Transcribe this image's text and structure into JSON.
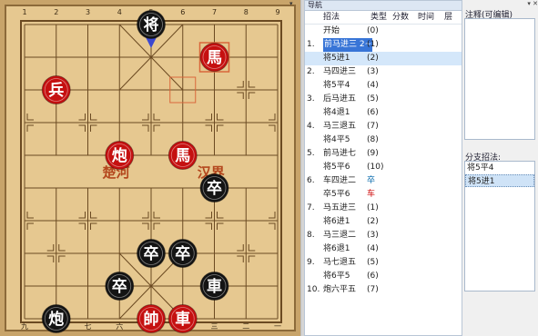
{
  "board": {
    "top_file_labels": [
      "1",
      "2",
      "3",
      "4",
      "5",
      "6",
      "7",
      "8",
      "9"
    ],
    "bottom_file_labels": [
      "九",
      "八",
      "七",
      "六",
      "五",
      "四",
      "三",
      "二",
      "一"
    ],
    "river_left": "楚河",
    "river_right": "汉界",
    "pieces": [
      {
        "char": "将",
        "side": "black",
        "col": 4,
        "row": 0
      },
      {
        "char": "馬",
        "side": "red",
        "col": 6,
        "row": 1
      },
      {
        "char": "兵",
        "side": "red",
        "col": 1,
        "row": 2
      },
      {
        "char": "炮",
        "side": "red",
        "col": 3,
        "row": 4
      },
      {
        "char": "馬",
        "side": "red",
        "col": 5,
        "row": 4
      },
      {
        "char": "卒",
        "side": "black",
        "col": 6,
        "row": 5
      },
      {
        "char": "卒",
        "side": "black",
        "col": 4,
        "row": 7
      },
      {
        "char": "卒",
        "side": "black",
        "col": 5,
        "row": 7
      },
      {
        "char": "卒",
        "side": "black",
        "col": 3,
        "row": 8
      },
      {
        "char": "車",
        "side": "black",
        "col": 6,
        "row": 8
      },
      {
        "char": "炮",
        "side": "black",
        "col": 1,
        "row": 9
      },
      {
        "char": "帥",
        "side": "red",
        "col": 4,
        "row": 9
      },
      {
        "char": "車",
        "side": "red",
        "col": 5,
        "row": 9
      }
    ],
    "colors": {
      "wood": "#e6c890",
      "line": "#6b4a22",
      "red": "#c51010",
      "black": "#141414",
      "river_text": "#b4481e",
      "highlight": "#d9673b",
      "arrow": "#3c48d0"
    }
  },
  "nav": {
    "title": "导航",
    "columns": {
      "move": "招法",
      "type": "类型",
      "score": "分数",
      "time": "时间",
      "depth": "层"
    },
    "rows": [
      {
        "num": "",
        "move": "开始",
        "idx": "(0)",
        "type": "",
        "type_color": "",
        "selected": false
      },
      {
        "num": "1.",
        "move": "前马进三 2~",
        "idx": "(1)",
        "type": "",
        "type_color": "",
        "selected": false,
        "hl": true
      },
      {
        "num": "",
        "move": "将5进1",
        "idx": "(2)",
        "type": "",
        "type_color": "",
        "selected": true
      },
      {
        "num": "2.",
        "move": "马四进三",
        "idx": "(3)",
        "type": "",
        "type_color": "",
        "selected": false
      },
      {
        "num": "",
        "move": "将5平4",
        "idx": "(4)",
        "type": "",
        "type_color": "",
        "selected": false
      },
      {
        "num": "3.",
        "move": "后马进五",
        "idx": "(5)",
        "type": "",
        "type_color": "",
        "selected": false
      },
      {
        "num": "",
        "move": "将4退1",
        "idx": "(6)",
        "type": "",
        "type_color": "",
        "selected": false
      },
      {
        "num": "4.",
        "move": "马三退五",
        "idx": "(7)",
        "type": "",
        "type_color": "",
        "selected": false
      },
      {
        "num": "",
        "move": "将4平5",
        "idx": "(8)",
        "type": "",
        "type_color": "",
        "selected": false
      },
      {
        "num": "5.",
        "move": "前马进七",
        "idx": "(9)",
        "type": "",
        "type_color": "",
        "selected": false
      },
      {
        "num": "",
        "move": "将5平6",
        "idx": "(10)",
        "type": "",
        "type_color": "",
        "selected": false
      },
      {
        "num": "6.",
        "move": "车四进二",
        "idx": "",
        "type": "卒",
        "type_color": "blue",
        "selected": false
      },
      {
        "num": "",
        "move": "卒5平6",
        "idx": "",
        "type": "车",
        "type_color": "red",
        "selected": false
      },
      {
        "num": "7.",
        "move": "马五进三",
        "idx": "(1)",
        "type": "",
        "type_color": "",
        "selected": false
      },
      {
        "num": "",
        "move": "将6进1",
        "idx": "(2)",
        "type": "",
        "type_color": "",
        "selected": false
      },
      {
        "num": "8.",
        "move": "马三退二",
        "idx": "(3)",
        "type": "",
        "type_color": "",
        "selected": false
      },
      {
        "num": "",
        "move": "将6退1",
        "idx": "(4)",
        "type": "",
        "type_color": "",
        "selected": false
      },
      {
        "num": "9.",
        "move": "马七退五",
        "idx": "(5)",
        "type": "",
        "type_color": "",
        "selected": false
      },
      {
        "num": "",
        "move": "将6平5",
        "idx": "(6)",
        "type": "",
        "type_color": "",
        "selected": false
      },
      {
        "num": "10.",
        "move": "炮六平五",
        "idx": "(7)",
        "type": "",
        "type_color": "",
        "selected": false
      }
    ]
  },
  "notes": {
    "title": "注释(可编辑)"
  },
  "branch": {
    "title": "分支招法:",
    "items": [
      {
        "label": "将5平4",
        "selected": false
      },
      {
        "label": "将5进1",
        "selected": true
      }
    ]
  }
}
